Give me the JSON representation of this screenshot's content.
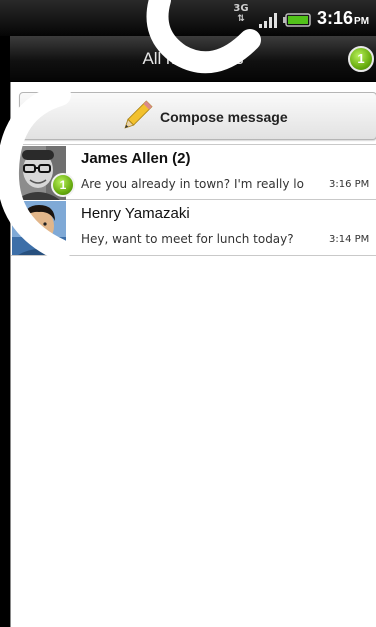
{
  "status_bar": {
    "network": "3G",
    "time": "3:16",
    "ampm": "PM"
  },
  "header": {
    "title": "All messages",
    "badge_count": "1"
  },
  "compose": {
    "label": "Compose message"
  },
  "threads": [
    {
      "name": "James Allen (2)",
      "snippet": "Are you already in town? I'm really lo",
      "time": "3:16 PM",
      "unread_count": "1"
    },
    {
      "name": "Henry Yamazaki",
      "snippet": "Hey, want to meet for lunch today?",
      "time": "3:14 PM"
    }
  ],
  "colors": {
    "badge_green": "#6aae10",
    "status_bar": "#050505",
    "battery_green": "#52c21a"
  },
  "icons": [
    "3g-icon",
    "signal-icon",
    "battery-icon",
    "pencil-icon",
    "avatar"
  ]
}
